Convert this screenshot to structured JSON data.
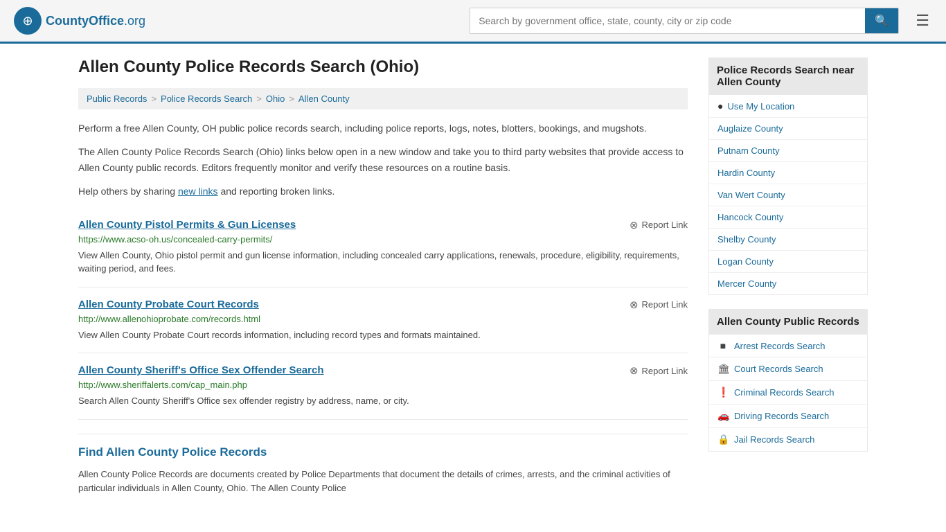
{
  "header": {
    "logo_text": "CountyOffice",
    "logo_org": ".org",
    "search_placeholder": "Search by government office, state, county, city or zip code",
    "search_value": ""
  },
  "page": {
    "title": "Allen County Police Records Search (Ohio)",
    "breadcrumb": [
      {
        "label": "Public Records",
        "href": "#"
      },
      {
        "label": "Police Records Search",
        "href": "#"
      },
      {
        "label": "Ohio",
        "href": "#"
      },
      {
        "label": "Allen County",
        "href": "#"
      }
    ]
  },
  "intro": {
    "para1": "Perform a free Allen County, OH public police records search, including police reports, logs, notes, blotters, bookings, and mugshots.",
    "para2": "The Allen County Police Records Search (Ohio) links below open in a new window and take you to third party websites that provide access to Allen County public records. Editors frequently monitor and verify these resources on a routine basis.",
    "para3_prefix": "Help others by sharing ",
    "new_links_text": "new links",
    "para3_suffix": " and reporting broken links."
  },
  "records": [
    {
      "title": "Allen County Pistol Permits & Gun Licenses",
      "url": "https://www.acso-oh.us/concealed-carry-permits/",
      "description": "View Allen County, Ohio pistol permit and gun license information, including concealed carry applications, renewals, procedure, eligibility, requirements, waiting period, and fees.",
      "report_label": "Report Link"
    },
    {
      "title": "Allen County Probate Court Records",
      "url": "http://www.allenohioprobate.com/records.html",
      "description": "View Allen County Probate Court records information, including record types and formats maintained.",
      "report_label": "Report Link"
    },
    {
      "title": "Allen County Sheriff's Office Sex Offender Search",
      "url": "http://www.sheriffalerts.com/cap_main.php",
      "description": "Search Allen County Sheriff's Office sex offender registry by address, name, or city.",
      "report_label": "Report Link"
    }
  ],
  "find_section": {
    "title": "Find Allen County Police Records",
    "description": "Allen County Police Records are documents created by Police Departments that document the details of crimes, arrests, and the criminal activities of particular individuals in Allen County, Ohio. The Allen County Police"
  },
  "sidebar": {
    "nearby_title": "Police Records Search near Allen County",
    "use_my_location": "Use My Location",
    "nearby_counties": [
      {
        "label": "Auglaize County"
      },
      {
        "label": "Putnam County"
      },
      {
        "label": "Hardin County"
      },
      {
        "label": "Van Wert County"
      },
      {
        "label": "Hancock County"
      },
      {
        "label": "Shelby County"
      },
      {
        "label": "Logan County"
      },
      {
        "label": "Mercer County"
      }
    ],
    "public_records_title": "Allen County Public Records",
    "public_records": [
      {
        "label": "Arrest Records Search",
        "icon": "■"
      },
      {
        "label": "Court Records Search",
        "icon": "🏛"
      },
      {
        "label": "Criminal Records Search",
        "icon": "❗"
      },
      {
        "label": "Driving Records Search",
        "icon": "🚗"
      },
      {
        "label": "Jail Records Search",
        "icon": "🔒"
      }
    ]
  }
}
